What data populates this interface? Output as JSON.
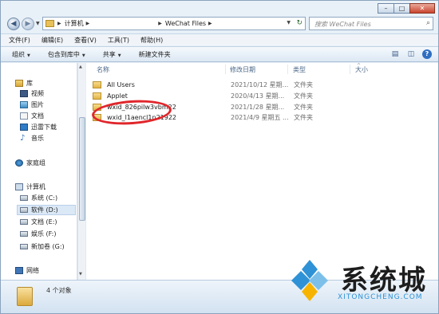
{
  "address": {
    "crumbs": [
      "计算机",
      "WeChat Files"
    ],
    "search_placeholder": "搜索 WeChat Files"
  },
  "menu": [
    "文件(F)",
    "编辑(E)",
    "查看(V)",
    "工具(T)",
    "帮助(H)"
  ],
  "toolbar": {
    "organize": "组织",
    "include": "包含到库中",
    "share": "共享",
    "new_folder": "新建文件夹"
  },
  "nav": {
    "library": "库",
    "videos": "视频",
    "pictures": "图片",
    "documents": "文档",
    "thunder": "迅雷下载",
    "music": "音乐",
    "homegroup": "家庭组",
    "computer": "计算机",
    "drive_c": "系统 (C:)",
    "drive_d": "软件 (D:)",
    "drive_e": "文档 (E:)",
    "drive_f": "娱乐 (F:)",
    "drive_g": "新加卷 (G:)",
    "network": "网络"
  },
  "columns": {
    "name": "名称",
    "date": "修改日期",
    "type": "类型",
    "size": "大小"
  },
  "files": [
    {
      "name": "All Users",
      "date": "2021/10/12 星期...",
      "type": "文件夹"
    },
    {
      "name": "Applet",
      "date": "2020/4/13 星期...",
      "type": "文件夹"
    },
    {
      "name": "wxid_826pilw3vbm22",
      "date": "2021/1/28 星期...",
      "type": "文件夹"
    },
    {
      "name": "wxid_l1aencl1n21922",
      "date": "2021/4/9 星期五 ...",
      "type": "文件夹"
    }
  ],
  "status": {
    "count": "4 个对象"
  },
  "watermark": {
    "title": "系统城",
    "url": "XITONGCHENG.COM"
  },
  "colors": {
    "highlight": "#e0262b",
    "watermark_blue": "#2f92d6"
  }
}
